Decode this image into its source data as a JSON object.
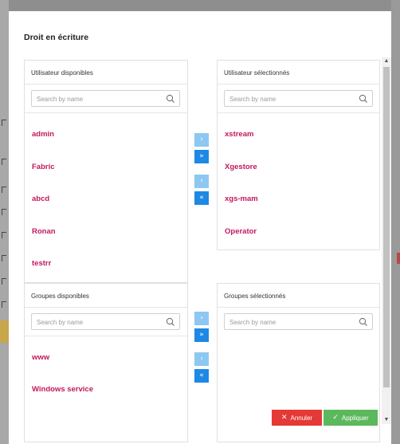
{
  "modal": {
    "title": "Droit en écriture"
  },
  "available_users": {
    "title": "Utilisateur disponibles",
    "search_placeholder": "Search by name",
    "items": [
      "admin",
      "Fabric",
      "abcd",
      "Ronan",
      "testrr"
    ]
  },
  "selected_users": {
    "title": "Utilisateur sélectionnés",
    "search_placeholder": "Search by name",
    "items": [
      "xstream",
      "Xgestore",
      "xgs-mam",
      "Operator"
    ]
  },
  "available_groups": {
    "title": "Groupes disponibles",
    "search_placeholder": "Search by name",
    "items": [
      "www",
      "Windows service"
    ]
  },
  "selected_groups": {
    "title": "Groupes sélectionnés",
    "search_placeholder": "Search by name",
    "items": []
  },
  "transfer_buttons": {
    "move_right": "›",
    "move_all_right": "»",
    "move_left": "‹",
    "move_all_left": "«"
  },
  "footer": {
    "cancel_label": "Annuler",
    "apply_label": "Appliquer"
  },
  "colors": {
    "item_text": "#c2185b",
    "transfer_light": "#8cc8f2",
    "transfer_dark": "#1e88e5",
    "cancel": "#e53935",
    "apply": "#5cb85c"
  }
}
